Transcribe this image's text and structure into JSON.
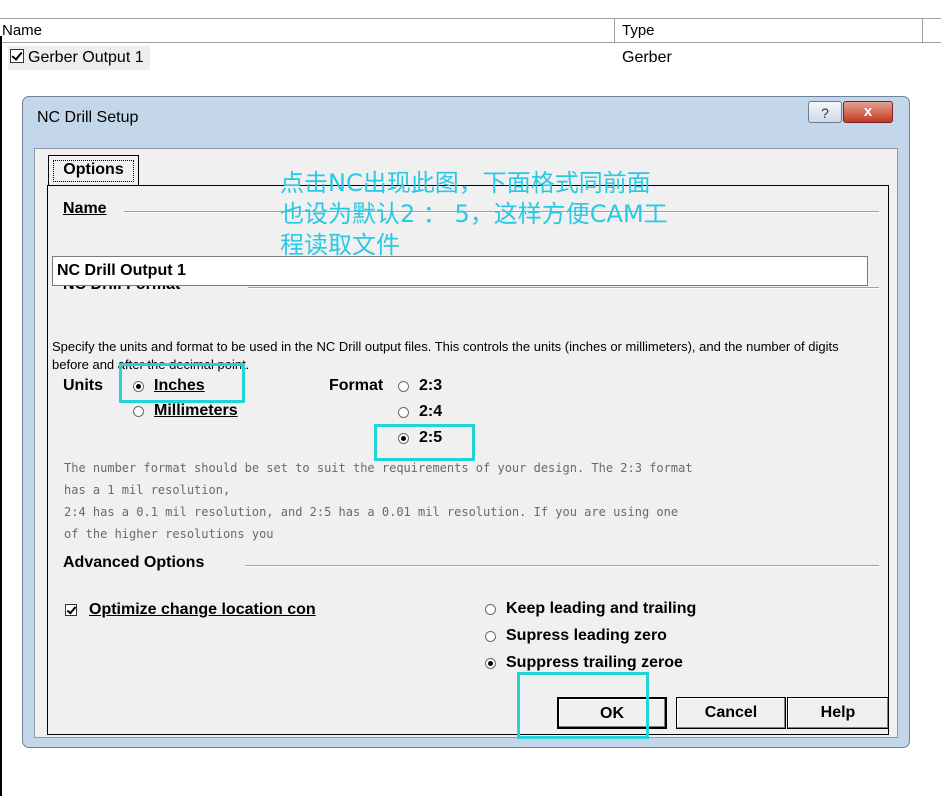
{
  "list": {
    "columns": {
      "name": "Name",
      "type": "Type"
    },
    "rows": [
      {
        "name": "Gerber Output 1",
        "type": "Gerber",
        "checked": true
      }
    ]
  },
  "dialog": {
    "title": "NC Drill Setup",
    "help_glyph": "?",
    "close_glyph": "x",
    "tab": "Options",
    "name_section": "Name",
    "name_value": "NC Drill Output 1",
    "format_section": "NC Drill Format",
    "description": "Specify the units and format to be used in the NC Drill output files. This controls the units (inches or millimeters), and the number of digits before and after the decimal point.",
    "units_label": "Units",
    "units_options": [
      "Inches",
      "Millimeters"
    ],
    "units_selected": "Inches",
    "format_label": "Format",
    "format_options": [
      "2:3",
      "2:4",
      "2:5"
    ],
    "format_selected": "2:5",
    "help_text": "The number format should be set to suit the requirements of your design. The 2:3 format\nhas a 1 mil resolution,\n2:4 has a 0.1 mil resolution, and 2:5 has a 0.01 mil resolution. If you are using one\nof the higher resolutions you",
    "advanced_section": "Advanced Options",
    "optimize_label": "Optimize change location con",
    "optimize_checked": true,
    "zero_options": [
      "Keep leading and trailing",
      "Supress leading zero",
      "Suppress trailing zeroe"
    ],
    "zero_selected": "Suppress trailing zeroe",
    "buttons": {
      "ok": "OK",
      "cancel": "Cancel",
      "help": "Help"
    }
  },
  "annotation": {
    "lines": [
      "点击NC出现此图，下面格式同前面",
      "也设为默认2 ： 5，这样方便CAM工",
      "程读取文件"
    ],
    "color": "#28c9e4"
  },
  "colors": {
    "highlight": "#22d3d8",
    "dialog_frame": "#c4d6ea",
    "client": "#f0f0f0"
  }
}
